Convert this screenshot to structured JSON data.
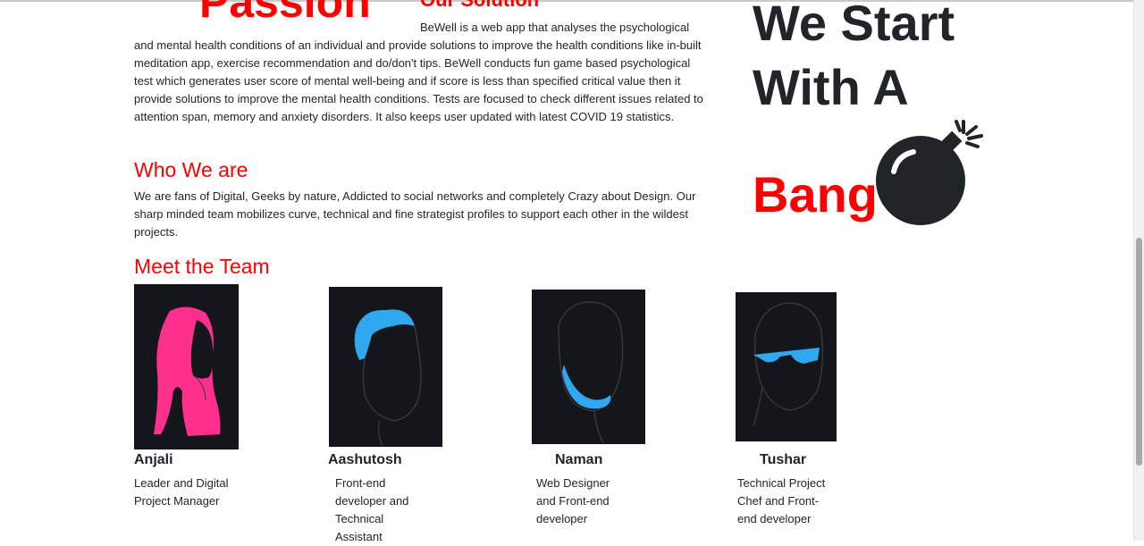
{
  "top": {
    "passion_heading": "Passion",
    "solution_heading": "Our Solution"
  },
  "solution": {
    "text_first": "BeWell is a web app that analyses the psychological",
    "text_rest": "and mental health conditions of an individual and provide solutions to improve the health conditions like in-built meditation app, exercise recommendation and do/don't tips. BeWell conducts fun game based psychological test which generates user score of mental well-being and if score is less than specified critical value then it provide solutions to improve the mental health conditions. Tests are focused to check different issues related to attention span, memory and anxiety disorders. It also keeps user updated with latest COVID 19 statistics."
  },
  "who": {
    "heading": "Who We are",
    "text": "We are fans of Digital, Geeks by nature, Addicted to social networks and completely Crazy about Design. Our sharp minded team mobilizes curve, technical and fine strategist profiles to support each other in the wildest projects."
  },
  "team": {
    "heading": "Meet the Team",
    "members": [
      {
        "name": "Anjali",
        "role": "Leader and Digital Project Manager"
      },
      {
        "name": "Aashutosh",
        "role": "Front-end developer and Technical Assistant"
      },
      {
        "name": "Naman",
        "role": "Web Designer and Front-end developer"
      },
      {
        "name": "Tushar",
        "role": "Technical Project Chef and Front-end developer"
      }
    ]
  },
  "hero": {
    "line1": "We Start",
    "line2": "With A",
    "line3": "Bang",
    "icon": "bomb-icon"
  },
  "colors": {
    "accent": "#ff0000",
    "text": "#212529",
    "avatar_bg": "#15151c",
    "avatar_pink": "#ff2f8e",
    "avatar_blue": "#2fa8f0"
  }
}
